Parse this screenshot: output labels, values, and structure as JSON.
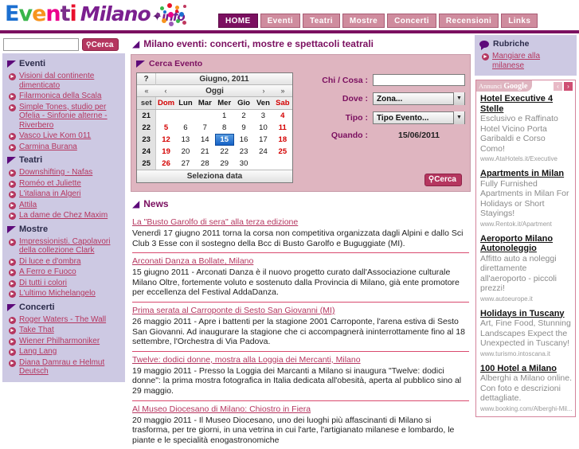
{
  "site": {
    "logo_letters": [
      "E",
      "v",
      "e",
      "n",
      "t",
      "i"
    ],
    "logo_word2": "Milano",
    "logo_star": "✦",
    "logo_info": "info"
  },
  "nav": {
    "items": [
      {
        "label": "HOME",
        "active": true
      },
      {
        "label": "Eventi",
        "active": false
      },
      {
        "label": "Teatri",
        "active": false
      },
      {
        "label": "Mostre",
        "active": false
      },
      {
        "label": "Concerti",
        "active": false
      },
      {
        "label": "Recensioni",
        "active": false
      },
      {
        "label": "Links",
        "active": false
      }
    ]
  },
  "search": {
    "value": "",
    "placeholder": "",
    "button_label": "Cerca"
  },
  "sidebar": {
    "categories": [
      {
        "name": "Eventi",
        "items": [
          "Visioni dal continente dimenticato",
          "Filarmonica della Scala",
          "Simple Tones, studio per Ofelia - Sinfonie alterne - Riverbero",
          "Vasco Live Kom 011",
          "Carmina Burana"
        ]
      },
      {
        "name": "Teatri",
        "items": [
          "Downshifting - Nafas",
          "Roméo et Juliette",
          "L'italiana in Algeri",
          "Attila",
          "La dame de Chez Maxim"
        ]
      },
      {
        "name": "Mostre",
        "items": [
          "Impressionisti. Capolavori della collezione Clark",
          "Di luce e d'ombra",
          "A Ferro e Fuoco",
          "Di tutti i colori",
          "L'ultimo Michelangelo"
        ]
      },
      {
        "name": "Concerti",
        "items": [
          "Roger Waters - The Wall",
          "Take That",
          "Wiener Philharmoniker",
          "Lang Lang",
          "Diana Damrau e Helmut Deutsch"
        ]
      }
    ]
  },
  "main": {
    "page_title": "Milano eventi: concerti, mostre e spettacoli teatrali",
    "search_panel": {
      "title": "Cerca Evento",
      "calendar": {
        "help": "?",
        "month_year": "Giugno, 2011",
        "today_label": "Oggi",
        "prev_year": "«",
        "prev_month": "‹",
        "next_month": "›",
        "next_year": "»",
        "week_col_header": "set",
        "day_headers": [
          "Dom",
          "Lun",
          "Mar",
          "Mer",
          "Gio",
          "Ven",
          "Sab"
        ],
        "weeks": [
          {
            "num": "21",
            "days": [
              "",
              "",
              "",
              "1",
              "2",
              "3",
              "4"
            ]
          },
          {
            "num": "22",
            "days": [
              "5",
              "6",
              "7",
              "8",
              "9",
              "10",
              "11"
            ]
          },
          {
            "num": "23",
            "days": [
              "12",
              "13",
              "14",
              "15",
              "16",
              "17",
              "18"
            ]
          },
          {
            "num": "24",
            "days": [
              "19",
              "20",
              "21",
              "22",
              "23",
              "24",
              "25"
            ]
          },
          {
            "num": "25",
            "days": [
              "26",
              "27",
              "28",
              "29",
              "30",
              "",
              ""
            ]
          }
        ],
        "selected_day": "15",
        "footer_label": "Seleziona data"
      },
      "fields": {
        "who_label": "Chi / Cosa :",
        "who_value": "",
        "where_label": "Dove :",
        "where_value": "Zona...",
        "type_label": "Tipo :",
        "type_value": "Tipo Evento...",
        "when_label": "Quando :",
        "when_value": "15/06/2011"
      },
      "submit_label": "Cerca"
    },
    "news_title": "News",
    "news": [
      {
        "title": "La \"Busto Garolfo di sera\" alla terza edizione",
        "body": "Venerdì 17 giugno 2011 torna la corsa non competitiva organizzata dagli Alpini e dallo Sci Club 3 Esse con il sostegno della Bcc di Busto Garolfo e Buguggiate (MI)."
      },
      {
        "title": "Arconati Danza a Bollate, Milano",
        "body": "15 giugno 2011 - Arconati Danza è il nuovo progetto curato dall'Associazione culturale Milano Oltre, fortemente voluto e sostenuto dalla Provincia di Milano, già ente promotore per eccellenza del Festival AddaDanza."
      },
      {
        "title": "Prima serata al Carroponte di Sesto San Giovanni (MI)",
        "body": "26 maggio 2011 - Apre i battenti per la stagione 2001 Carroponte, l'arena estiva di Sesto San Giovanni. Ad inaugurare la stagione che ci accompagnerà ininterrottamente fino al 18 settembre, l'Orchestra di Via Padova."
      },
      {
        "title": "Twelve: dodici donne, mostra alla Loggia dei Mercanti, Milano",
        "body": "19 maggio 2011 - Presso la Loggia dei Marcanti a Milano si inaugura \"Twelve: dodici donne\": la prima mostra fotografica in Italia dedicata all'obesità, aperta al pubblico sino al 29 maggio."
      },
      {
        "title": "Al Museo Diocesano di Milano: Chiostro in Fiera",
        "body": "20 maggio 2011 - Il Museo Diocesano, uno dei luoghi più affascinanti di Milano si trasforma, per tre giorni, in una vetrina in cui l'arte, l'artigianato milanese e lombardo, le piante e le specialità enogastronomiche"
      }
    ]
  },
  "rightbar": {
    "rubriche_title": "Rubriche",
    "rubriche_items": [
      "Mangiare alla milanese"
    ],
    "ads_header": {
      "label_small": "Annunci",
      "label_brand": "Google",
      "prev": "‹",
      "next": "›"
    },
    "ads": [
      {
        "title": "Hotel Executive 4 Stelle",
        "desc": "Esclusivo e Raffinato Hotel Vicino Porta Garibaldi e Corso Como!",
        "url": "www.AtaHotels.it/Executive"
      },
      {
        "title": "Apartments in Milan",
        "desc": "Fully Furnished Apartments in Milan For Holidays or Short Stayings!",
        "url": "www.Rentok.it/Apartment"
      },
      {
        "title": "Aeroporto Milano Autonoleggio",
        "desc": "Affitto auto a noleggi direttamente all'aeroporto - piccoli prezzi!",
        "url": "www.autoeurope.it"
      },
      {
        "title": "Holidays in Tuscany",
        "desc": "Art, Fine Food, Stunning Landscapes Expect the Unexpected in Tuscany!",
        "url": "www.turismo.intoscana.it"
      },
      {
        "title": "100 Hotel a Milano",
        "desc": "Alberghi a Milano online. Con foto e descrizioni dettagliate.",
        "url": "www.booking.com/Alberghi-Mil..."
      }
    ]
  },
  "colors": {
    "brand_purple": "#7b1060",
    "link_pink": "#b5365f",
    "panel_lilac": "#cdc9e3",
    "panel_rose": "#dfb5c0",
    "selected_blue": "#1562c6"
  }
}
